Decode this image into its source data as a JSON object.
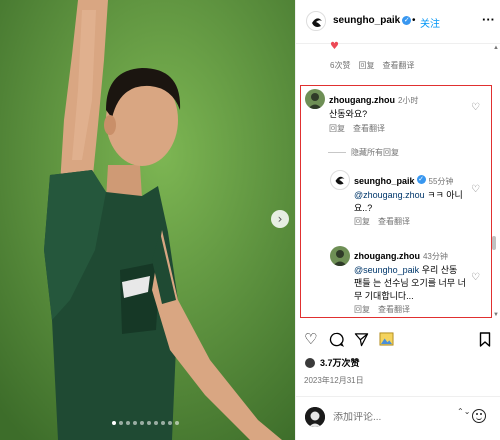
{
  "post": {
    "username": "seungho_paik",
    "verified_mark": "✓",
    "separator": "•",
    "follow_label": "关注",
    "more_icon": "more-horizontal-icon"
  },
  "photo": {
    "next_glyph": "›",
    "carousel_dots": 10,
    "active_dot_index": 0
  },
  "top_comment_meta": {
    "heart_glyph": "♥",
    "likes": "6次赞",
    "reply": "回复",
    "translate": "查看翻译"
  },
  "comments": [
    {
      "username": "zhougang.zhou",
      "time": "2小时",
      "text": "산동와요?",
      "reply": "回复",
      "translate": "查看翻译"
    }
  ],
  "hide_replies_label": "隐藏所有回复",
  "replies": [
    {
      "username": "seungho_paik",
      "verified_mark": "✓",
      "time": "55分钟",
      "mention": "@zhougang.zhou",
      "text": " ㅋㅋ 아니요..?",
      "reply": "回复",
      "translate": "查看翻译"
    },
    {
      "username": "zhougang.zhou",
      "time": "43分钟",
      "mention": "@seungho_paik",
      "text": " 우리 산동 팬들 는 선수님 오기를 너무 너무 기대합니다...",
      "reply": "回复",
      "translate": "查看翻译"
    }
  ],
  "actions": {
    "like_icon": "heart-outline-icon",
    "comment_icon": "comment-bubble-icon",
    "share_icon": "paper-plane-icon",
    "emoji_button_icon": "image-icon",
    "save_icon": "bookmark-icon"
  },
  "likes": {
    "text": "3.7万次赞"
  },
  "date": "2023年12月31日",
  "compose": {
    "placeholder": "添加评论...",
    "arrow_glyph": "⌃⌄"
  },
  "colors": {
    "link_blue": "#0095f6",
    "highlight_border": "#e03030",
    "heart_red": "#ed4956",
    "kit_green": "#1f4a33"
  }
}
